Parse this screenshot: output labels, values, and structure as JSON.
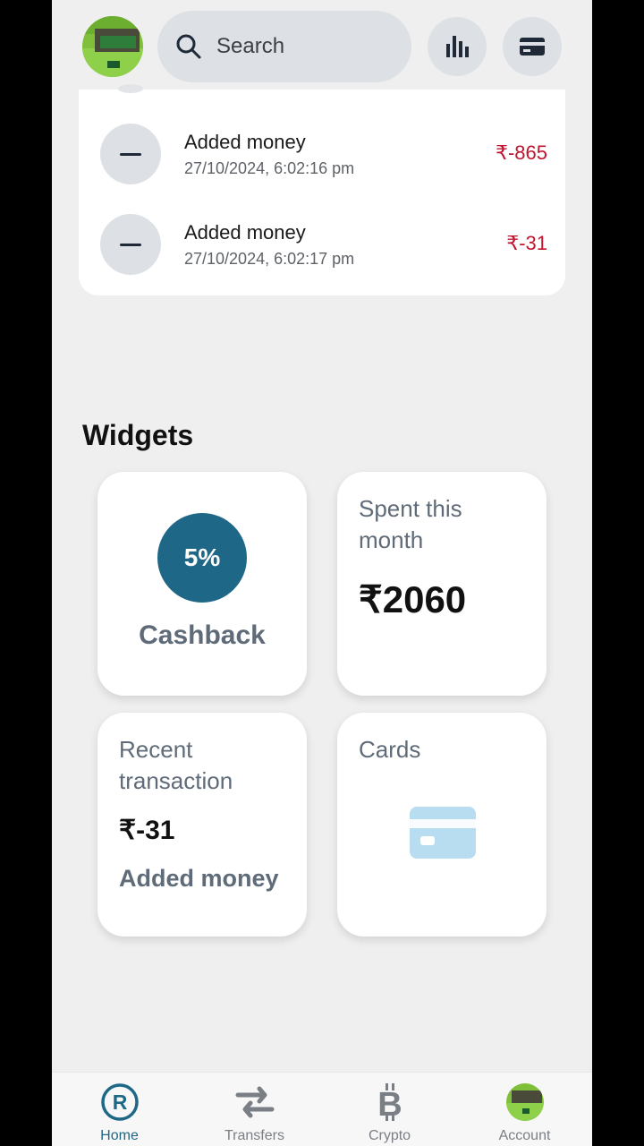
{
  "header": {
    "search_placeholder": "Search",
    "icons": [
      "avatar",
      "search-icon",
      "bar-chart-icon",
      "credit-card-icon"
    ]
  },
  "transactions": [
    {
      "title": "Added money",
      "date": "27/10/2024, 6:02:16 pm",
      "amount": "₹-865",
      "icon": "minus-icon"
    },
    {
      "title": "Added money",
      "date": "27/10/2024, 6:02:17 pm",
      "amount": "₹-31",
      "icon": "minus-icon"
    }
  ],
  "widgets": {
    "title": "Widgets",
    "cashback": {
      "percent": "5%",
      "label": "Cashback"
    },
    "spent": {
      "heading": "Spent this month",
      "amount": "₹2060"
    },
    "recent": {
      "heading": "Recent transaction",
      "amount": "₹-31",
      "label": "Added money"
    },
    "cards": {
      "heading": "Cards",
      "icon": "credit-card-icon"
    }
  },
  "nav": [
    {
      "label": "Home",
      "icon": "home-r-icon",
      "active": true
    },
    {
      "label": "Transfers",
      "icon": "transfer-arrows-icon",
      "active": false
    },
    {
      "label": "Crypto",
      "icon": "bitcoin-icon",
      "active": false
    },
    {
      "label": "Account",
      "icon": "avatar",
      "active": false
    }
  ],
  "colors": {
    "accent": "#1f6787",
    "negative_amount": "#c0152f",
    "background": "#efefef",
    "card": "#ffffff"
  }
}
